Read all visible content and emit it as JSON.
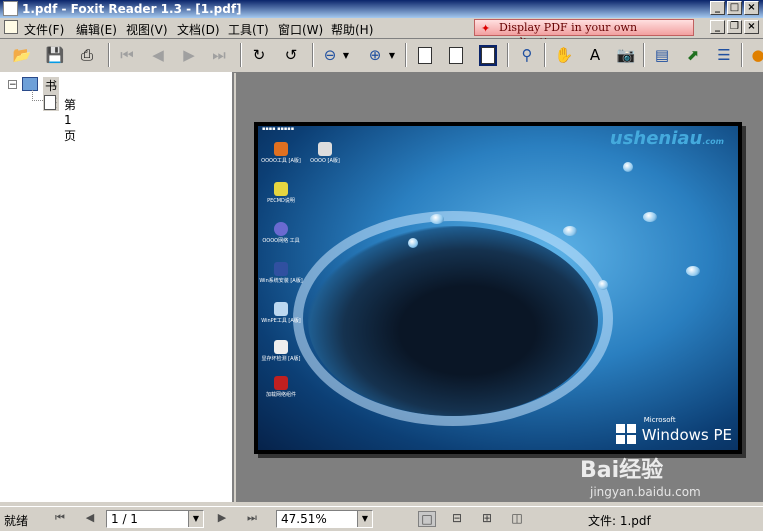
{
  "window": {
    "title": "1.pdf - Foxit Reader 1.3 - [1.pdf]"
  },
  "menu": {
    "items": [
      "文件(F)",
      "编辑(E)",
      "视图(V)",
      "文档(D)",
      "工具(T)",
      "窗口(W)",
      "帮助(H)"
    ],
    "banner": "Display PDF in your own applications"
  },
  "bookmarks": {
    "root": "书签",
    "children": [
      "第 1 页"
    ]
  },
  "document": {
    "desktop_icons": [
      "OOOO工具\n[A版]",
      "OOOO\n[A版]",
      "PECMD说明",
      "OOOO网络\n工具",
      "Win系统安装\n[A版]",
      "WinPE工具\n[A版]",
      "显存坏检测\n[A版]",
      "加载网络组件"
    ],
    "logo": "usheniau",
    "logo_sub": ".com",
    "os_brand": "Windows PE",
    "os_vendor": "Microsoft"
  },
  "statusbar": {
    "status": "就绪",
    "page": "1 / 1",
    "zoom": "47.51%",
    "file": "文件: 1.pdf"
  },
  "watermark": {
    "brand": "Bai经验",
    "url": "jingyan.baidu.com"
  },
  "colors": {
    "titlebar": "#0a246a",
    "banner": "#f2a0a0",
    "viewer_bg": "#7f7f7f"
  }
}
